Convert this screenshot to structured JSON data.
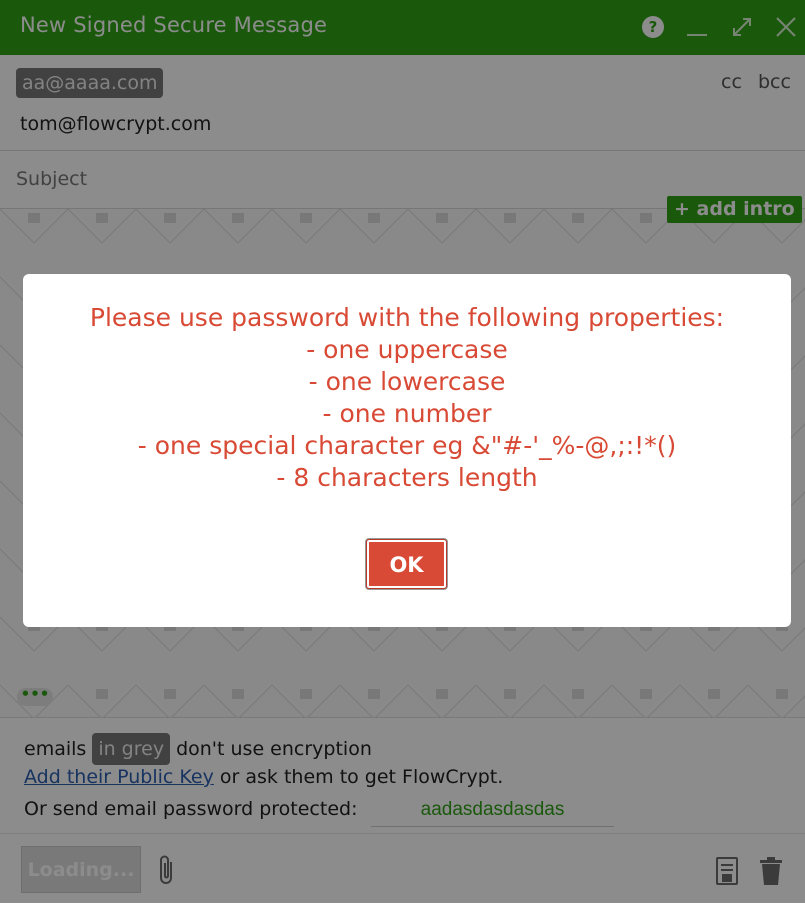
{
  "window": {
    "title": "New Signed Secure Message",
    "help_label": "?"
  },
  "recipients": {
    "chip": "aa@aaaa.com",
    "cc_label": "cc",
    "bcc_label": "bcc",
    "to_value": "tom@flowcrypt.com"
  },
  "subject": {
    "placeholder": "Subject"
  },
  "compose": {
    "add_intro_label": "+ add intro",
    "more_label": "•••"
  },
  "info": {
    "emails_prefix": "emails",
    "grey_chip": "in grey",
    "emails_suffix": "don't use encryption",
    "add_key_link": "Add their Public Key",
    "add_key_suffix": " or ask them to get FlowCrypt.",
    "password_label": "Or send email password protected:",
    "password_value": "aadasdasdasdas"
  },
  "toolbar": {
    "send_label": "Loading..."
  },
  "dialog": {
    "lines": [
      "Please use password with the following properties:",
      "- one uppercase",
      "- one lowercase",
      "- one number",
      "- one special character eg &\"#-'_%-@,;:!*()",
      "- 8 characters length"
    ],
    "ok_label": "OK"
  },
  "colors": {
    "brand_green": "#31a217",
    "error_red": "#d84a35",
    "link_blue": "#2a5db0"
  }
}
